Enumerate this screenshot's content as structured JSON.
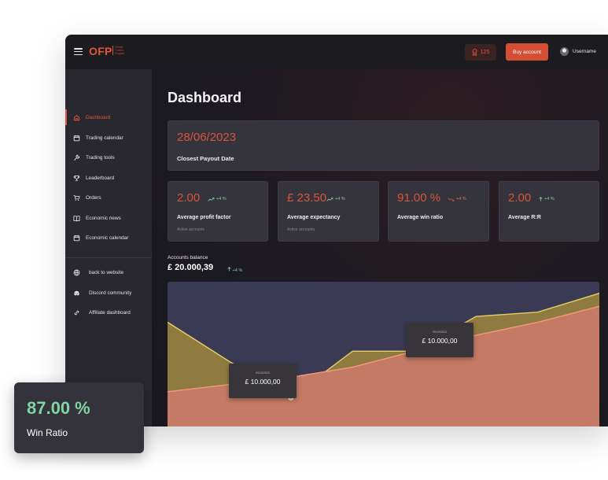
{
  "header": {
    "logo_text": "OFP",
    "logo_subtitle": "Overall Funded Program",
    "coins_count": "125",
    "buy_account_label": "Buy account",
    "username": "Username"
  },
  "sidebar": {
    "items": [
      {
        "label": "Dashboard",
        "icon": "home-icon",
        "active": true
      },
      {
        "label": "Trading calendar",
        "icon": "calendar-icon"
      },
      {
        "label": "Trading tools",
        "icon": "wrench-icon"
      },
      {
        "label": "Leaderboard",
        "icon": "trophy-icon"
      },
      {
        "label": "Orders",
        "icon": "cart-icon"
      },
      {
        "label": "Economic news",
        "icon": "book-icon"
      },
      {
        "label": "Economic calendar",
        "icon": "calendar-icon"
      }
    ],
    "links": [
      {
        "label": "back to website",
        "icon": "globe-icon"
      },
      {
        "label": "Discord community",
        "icon": "discord-icon"
      },
      {
        "label": "Affiliate dashboard",
        "icon": "link-icon"
      }
    ]
  },
  "main": {
    "title": "Dashboard",
    "payout": {
      "date": "28/06/2023",
      "label": "Closest Payout Date"
    },
    "stats": [
      {
        "value": "2.00",
        "change": "+4 %",
        "trend": "up",
        "name": "Average profit factor",
        "sub": "Active accounts"
      },
      {
        "value": "£ 23.50",
        "change": "+4 %",
        "trend": "up",
        "name": "Average expectancy",
        "sub": "Active accounts"
      },
      {
        "value": "91.00 %",
        "change": "+4 %",
        "trend": "down",
        "name": "Average win ratio",
        "sub": ""
      },
      {
        "value": "2.00",
        "change": "+4 %",
        "trend": "up",
        "name": "Average R:R",
        "sub": ""
      }
    ],
    "balance": {
      "label": "Accounts balance",
      "value": "£ 20.000,39",
      "change": "+4 %"
    },
    "tooltips": [
      {
        "date": "09/10/2023",
        "value": "£ 10.000,00"
      },
      {
        "date": "09/10/2023",
        "value": "£ 10.000,00"
      }
    ]
  },
  "chart_data": {
    "type": "area",
    "title": "",
    "xlabel": "",
    "ylabel": "",
    "x": [
      0,
      1,
      2,
      3,
      4,
      5,
      6,
      7
    ],
    "ylim": [
      0,
      100
    ],
    "series": [
      {
        "values": [
          72,
          45,
          20,
          52,
          52,
          76,
          79,
          92
        ],
        "color": "#8f7a3f",
        "line_color": "#e6cf63"
      },
      {
        "values": [
          24,
          29,
          34,
          41,
          52,
          63,
          72,
          83
        ],
        "color": "#c47a64",
        "line_color": "#f29a80"
      }
    ],
    "grid": false,
    "legend": "none"
  },
  "overlay": {
    "value": "87.00 %",
    "label": "Win Ratio"
  }
}
